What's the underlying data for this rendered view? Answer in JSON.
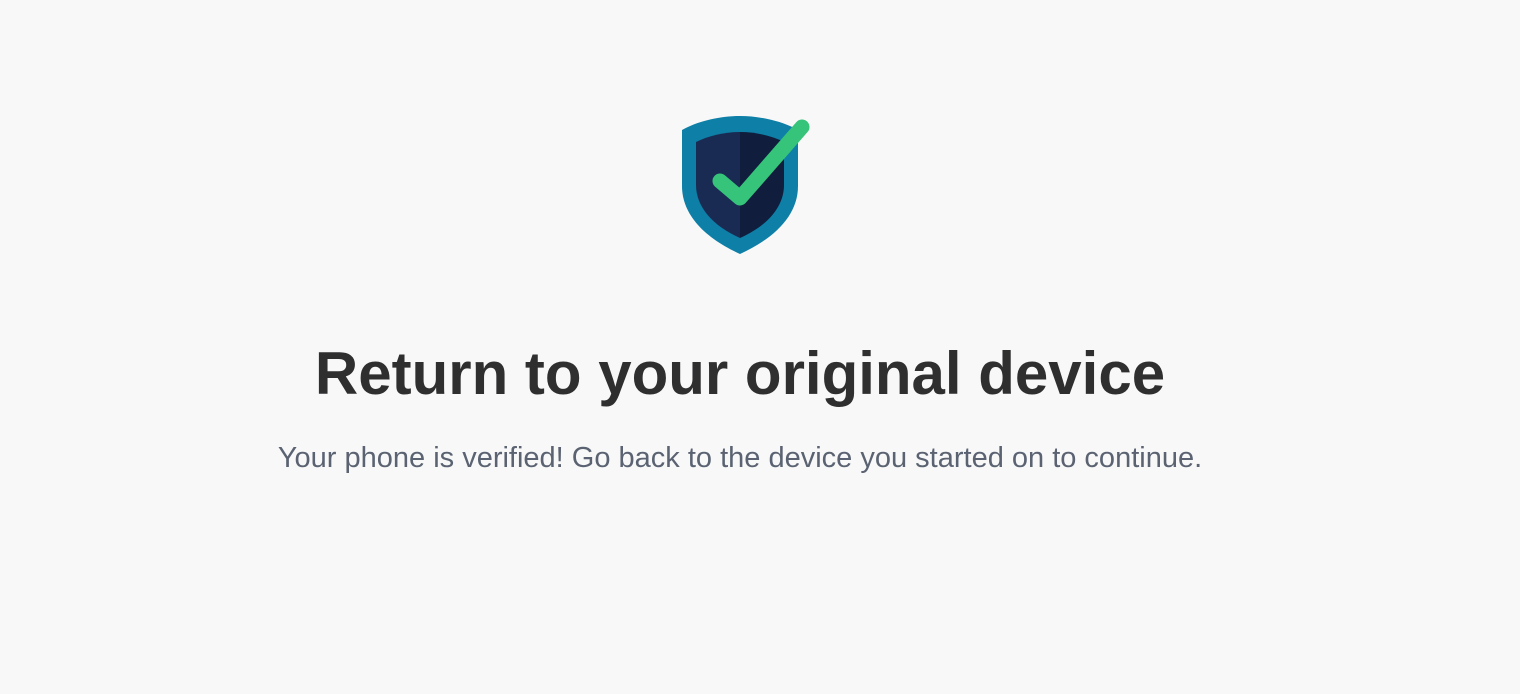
{
  "verification": {
    "icon": "shield-check-icon",
    "title": "Return to your original device",
    "message": "Your phone is verified! Go back to the device you started on to continue."
  },
  "colors": {
    "background": "#f8f8f9",
    "shield_outer": "#0e7fa6",
    "shield_inner_left": "#1a2b53",
    "shield_inner_right": "#101d3c",
    "checkmark": "#36c47a",
    "title": "#2f2f30",
    "message": "#5b6372"
  }
}
